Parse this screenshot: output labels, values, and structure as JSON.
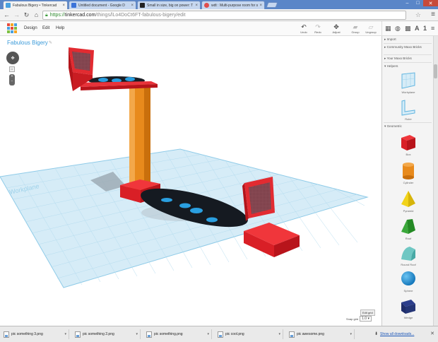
{
  "browser": {
    "tabs": [
      {
        "title": "Fabulous Bigery • Tinkercad",
        "favicon_color": "#4aa1e0"
      },
      {
        "title": "Untitled document - Google D",
        "favicon_color": "#3b73d9"
      },
      {
        "title": "Small in size, big on power: T",
        "favicon_color": "#222222"
      },
      {
        "title": "wdt : Multi-purpose room for s",
        "favicon_color": "#e04d4d"
      }
    ],
    "url_https": "https://",
    "url_host": "tinkercad.com",
    "url_path": "/things/lLo4DoCt6FT-fabulous-bigery/edit"
  },
  "tinkercad": {
    "menu": [
      "Design",
      "Edit",
      "Help"
    ],
    "tools": [
      {
        "label": "Undo",
        "icon": "undo-icon",
        "glyph": "↶"
      },
      {
        "label": "Redo",
        "icon": "redo-icon",
        "glyph": "↷"
      },
      {
        "label": "Adjust",
        "icon": "adjust-icon",
        "glyph": "✥"
      },
      {
        "label": "Group",
        "icon": "group-icon",
        "glyph": "▰"
      },
      {
        "label": "Ungroup",
        "icon": "ungroup-icon",
        "glyph": "▱"
      }
    ],
    "design_title": "Fabulous Bigery",
    "edit_grid_label": "Edit grid",
    "snap_grid_label": "Snap grid",
    "snap_grid_value": "1.0",
    "workplane_text": "Workplane"
  },
  "panel": {
    "sections": {
      "import": "Import",
      "community": "Community Maxx Bricks",
      "your_bricks": "Your Maxx Bricks",
      "helpers": "Helpers",
      "geometric": "Geometric"
    },
    "helpers": [
      "Workplane",
      "Ruler"
    ],
    "shapes": [
      {
        "label": "Box",
        "icon": "box-icon"
      },
      {
        "label": "Cylinder",
        "icon": "cylinder-icon"
      },
      {
        "label": "Pyramid",
        "icon": "pyramid-icon"
      },
      {
        "label": "Roof",
        "icon": "roof-icon"
      },
      {
        "label": "Round Roof",
        "icon": "round-roof-icon"
      },
      {
        "label": "Sphere",
        "icon": "sphere-icon"
      },
      {
        "label": "Wedge",
        "icon": "wedge-icon"
      }
    ]
  },
  "downloads": {
    "items": [
      "pic something 3.png",
      "pic something 2.png",
      "pic something.png",
      "pic cool.png",
      "pic awesome.png"
    ],
    "show_all": "Show all downloads..."
  }
}
